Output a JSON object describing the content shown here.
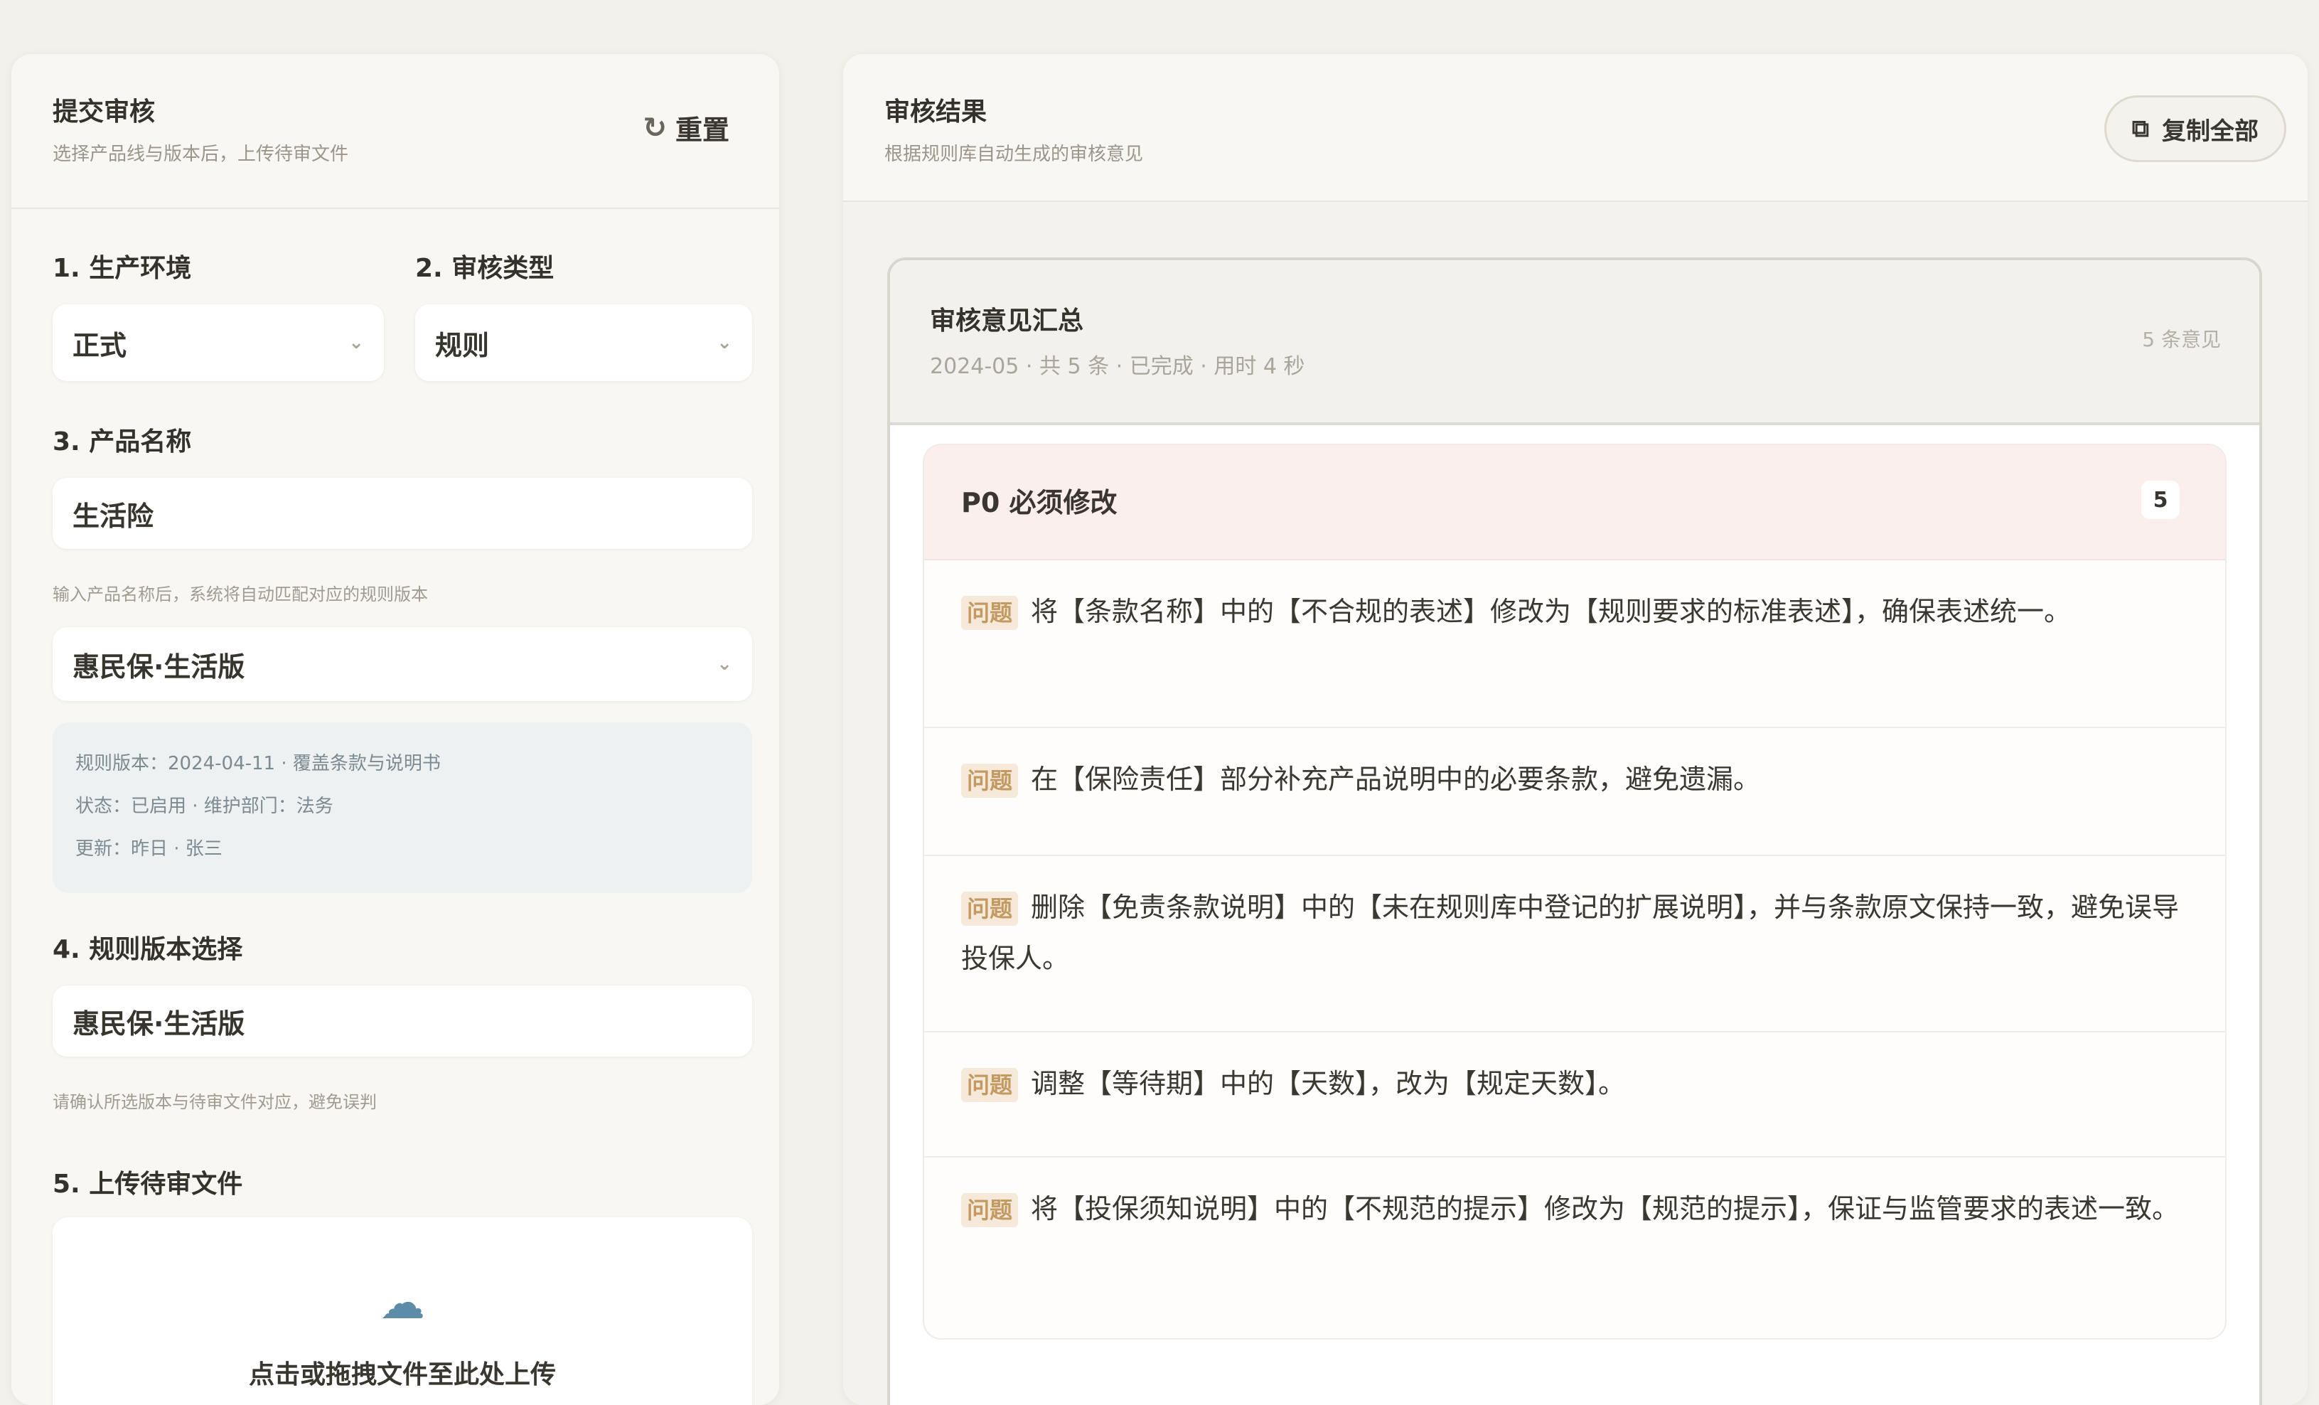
{
  "left": {
    "title": "提交审核",
    "subtitle": "选择产品线与版本后，上传待审文件",
    "reset_label": "重置",
    "f1_label": "1. 生产环境",
    "f1_value": "正式",
    "f2_label": "2. 审核类型",
    "f2_value": "规则",
    "f3_label": "3. 产品名称",
    "f3_value": "生活险",
    "f3_hint": "输入产品名称后，系统将自动匹配对应的规则版本",
    "product_select_value": "惠民保·生活版",
    "info_lines": [
      "规则版本：2024-04-11 · 覆盖条款与说明书",
      "状态：已启用 · 维护部门：法务",
      "更新：昨日 · 张三"
    ],
    "f4_label": "4. 规则版本选择",
    "f4_value": "惠民保·生活版",
    "f4_hint": "请确认所选版本与待审文件对应，避免误判",
    "f5_label": "5. 上传待审文件",
    "upload_text": "点击或拖拽文件至此处上传"
  },
  "right": {
    "title": "审核结果",
    "subtitle": "根据规则库自动生成的审核意见",
    "copy_label": "复制全部",
    "report_title": "审核意见汇总",
    "report_meta": "2024-05 · 共 5 条 · 已完成 · 用时 4 秒",
    "report_count": "5 条意见",
    "group_title": "P0 必须修改",
    "group_count": "5",
    "tag_label": "问题",
    "issues": [
      "将【条款名称】中的【不合规的表述】修改为【规则要求的标准表述】，确保表述统一。",
      "在【保险责任】部分补充产品说明中的必要条款，避免遗漏。",
      "删除【免责条款说明】中的【未在规则库中登记的扩展说明】，并与条款原文保持一致，避免误导投保人。",
      "调整【等待期】中的【天数】，改为【规定天数】。",
      "将【投保须知说明】中的【不规范的提示】修改为【规范的提示】，保证与监管要求的表述一致。"
    ]
  },
  "colors": {
    "background": "#f2f0ea",
    "panel": "#f8f7f3",
    "tag_bg": "#f6e9d9",
    "tag_text": "#c39a62",
    "group_head_bg": "#fbefed",
    "info_bg": "#edf1f2"
  },
  "icons": {
    "reset": "refresh-icon",
    "copy": "copy-icon",
    "chevron": "chevron-down-icon",
    "upload": "cloud-upload-icon"
  }
}
